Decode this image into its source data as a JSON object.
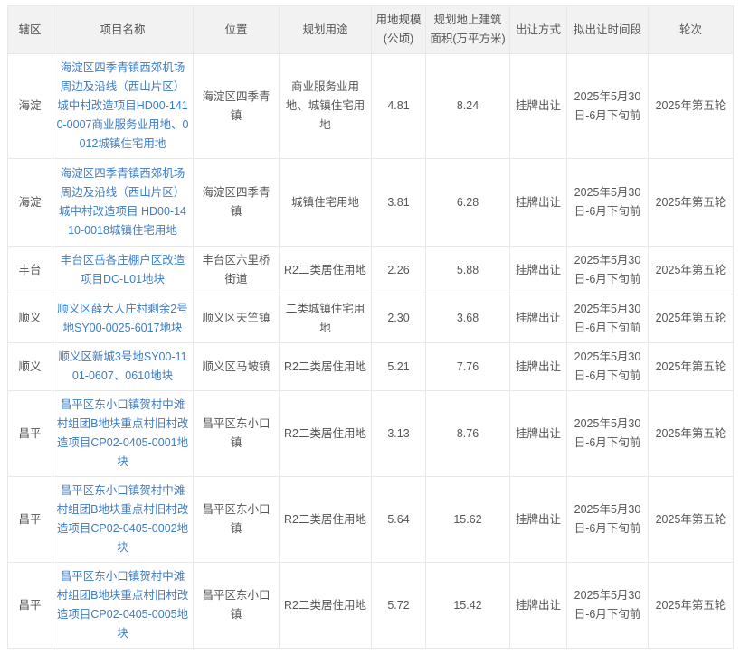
{
  "colors": {
    "link_blue": "#3d7dc4",
    "header_bg": "#f2f2f2",
    "border": "#e8e8e8",
    "text": "#555555"
  },
  "table": {
    "columns": [
      "辖区",
      "项目名称",
      "位置",
      "规划用途",
      "用地规模(公顷)",
      "规划地上建筑面积(万平方米)",
      "出让方式",
      "拟出让时间段",
      "轮次"
    ],
    "rows": [
      {
        "district": "海淀",
        "project": "海淀区四季青镇西郊机场周边及沿线（西山片区）城中村改造项目HD00-1410-0007商业服务业用地、0012城镇住宅用地",
        "location": "海淀区四季青镇",
        "usage": "商业服务业用地、城镇住宅用地",
        "area": "4.81",
        "building_area": "8.24",
        "method": "挂牌出让",
        "period": "2025年5月30日-6月下旬前",
        "round": "2025年第五轮"
      },
      {
        "district": "海淀",
        "project": "海淀区四季青镇西郊机场周边及沿线（西山片区）城中村改造项目 HD00-1410-0018城镇住宅用地",
        "location": "海淀区四季青镇",
        "usage": "城镇住宅用地",
        "area": "3.81",
        "building_area": "6.28",
        "method": "挂牌出让",
        "period": "2025年5月30日-6月下旬前",
        "round": "2025年第五轮"
      },
      {
        "district": "丰台",
        "project": "丰台区岳各庄棚户区改造项目DC-L01地块",
        "location": "丰台区六里桥街道",
        "usage": "R2二类居住用地",
        "area": "2.26",
        "building_area": "5.88",
        "method": "挂牌出让",
        "period": "2025年5月30日-6月下旬前",
        "round": "2025年第五轮"
      },
      {
        "district": "顺义",
        "project": "顺义区薛大人庄村剩余2号地SY00-0025-6017地块",
        "location": "顺义区天竺镇",
        "usage": "二类城镇住宅用地",
        "area": "2.30",
        "building_area": "3.68",
        "method": "挂牌出让",
        "period": "2025年5月30日-6月下旬前",
        "round": "2025年第五轮"
      },
      {
        "district": "顺义",
        "project": "顺义区新城3号地SY00-1101-0607、0610地块",
        "location": "顺义区马坡镇",
        "usage": "R2二类居住用地",
        "area": "5.21",
        "building_area": "7.76",
        "method": "挂牌出让",
        "period": "2025年5月30日-6月下旬前",
        "round": "2025年第五轮"
      },
      {
        "district": "昌平",
        "project": "昌平区东小口镇贺村中滩村组团B地块重点村旧村改造项目CP02-0405-0001地块",
        "location": "昌平区东小口镇",
        "usage": "R2二类居住用地",
        "area": "3.13",
        "building_area": "8.76",
        "method": "挂牌出让",
        "period": "2025年5月30日-6月下旬前",
        "round": "2025年第五轮"
      },
      {
        "district": "昌平",
        "project": "昌平区东小口镇贺村中滩村组团B地块重点村旧村改造项目CP02-0405-0002地块",
        "location": "昌平区东小口镇",
        "usage": "R2二类居住用地",
        "area": "5.64",
        "building_area": "15.62",
        "method": "挂牌出让",
        "period": "2025年5月30日-6月下旬前",
        "round": "2025年第五轮"
      },
      {
        "district": "昌平",
        "project": "昌平区东小口镇贺村中滩村组团B地块重点村旧村改造项目CP02-0405-0005地块",
        "location": "昌平区东小口镇",
        "usage": "R2二类居住用地",
        "area": "5.72",
        "building_area": "15.42",
        "method": "挂牌出让",
        "period": "2025年5月30日-6月下旬前",
        "round": "2025年第五轮"
      }
    ]
  }
}
